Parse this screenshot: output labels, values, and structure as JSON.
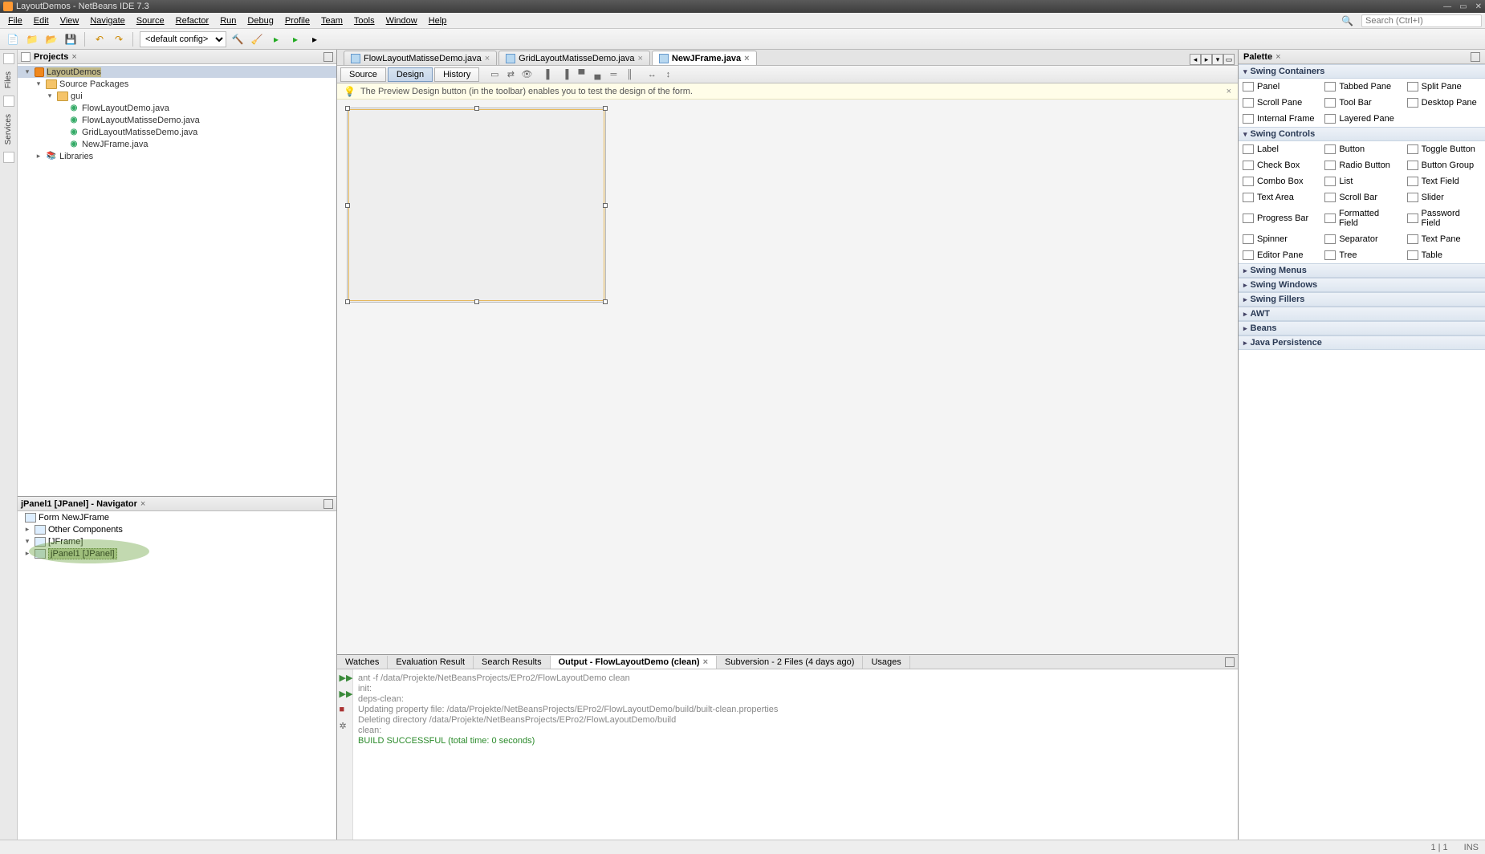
{
  "titlebar": {
    "text": "LayoutDemos - NetBeans IDE 7.3"
  },
  "menu": {
    "items": [
      "File",
      "Edit",
      "View",
      "Navigate",
      "Source",
      "Refactor",
      "Run",
      "Debug",
      "Profile",
      "Team",
      "Tools",
      "Window",
      "Help"
    ],
    "search_placeholder": "Search (Ctrl+I)"
  },
  "toolbar": {
    "config": "<default config>"
  },
  "leftrail": {
    "tabs": [
      "Files",
      "Services"
    ]
  },
  "projects": {
    "title": "Projects",
    "root": "LayoutDemos",
    "src": "Source Packages",
    "pkg": "gui",
    "files": [
      "FlowLayoutDemo.java",
      "FlowLayoutMatisseDemo.java",
      "GridLayoutMatisseDemo.java",
      "NewJFrame.java"
    ],
    "libs": "Libraries"
  },
  "navigator": {
    "title": "jPanel1 [JPanel] - Navigator",
    "form": "Form NewJFrame",
    "other": "Other Components",
    "jframe": "[JFrame]",
    "jpanel": "jPanel1 [JPanel]"
  },
  "editor_tabs": {
    "tabs": [
      {
        "label": "FlowLayoutMatisseDemo.java",
        "active": false
      },
      {
        "label": "GridLayoutMatisseDemo.java",
        "active": false
      },
      {
        "label": "NewJFrame.java",
        "active": true
      }
    ]
  },
  "ed_subbar": {
    "source": "Source",
    "design": "Design",
    "history": "History"
  },
  "hint": {
    "text": "The Preview Design button (in the toolbar) enables you to test the design of the form."
  },
  "palette": {
    "title": "Palette",
    "groups": [
      {
        "name": "Swing Containers",
        "open": true,
        "items": [
          "Panel",
          "Tabbed Pane",
          "Split Pane",
          "Scroll Pane",
          "Tool Bar",
          "Desktop Pane",
          "Internal Frame",
          "Layered Pane"
        ]
      },
      {
        "name": "Swing Controls",
        "open": true,
        "items": [
          "Label",
          "Button",
          "Toggle Button",
          "Check Box",
          "Radio Button",
          "Button Group",
          "Combo Box",
          "List",
          "Text Field",
          "Text Area",
          "Scroll Bar",
          "Slider",
          "Progress Bar",
          "Formatted Field",
          "Password Field",
          "Spinner",
          "Separator",
          "Text Pane",
          "Editor Pane",
          "Tree",
          "Table"
        ]
      },
      {
        "name": "Swing Menus",
        "open": false,
        "items": []
      },
      {
        "name": "Swing Windows",
        "open": false,
        "items": []
      },
      {
        "name": "Swing Fillers",
        "open": false,
        "items": []
      },
      {
        "name": "AWT",
        "open": false,
        "items": []
      },
      {
        "name": "Beans",
        "open": false,
        "items": []
      },
      {
        "name": "Java Persistence",
        "open": false,
        "items": []
      }
    ]
  },
  "bottom": {
    "tabs": [
      {
        "label": "Watches"
      },
      {
        "label": "Evaluation Result"
      },
      {
        "label": "Search Results"
      },
      {
        "label": "Output - FlowLayoutDemo (clean)",
        "active": true,
        "closable": true
      },
      {
        "label": "Subversion - 2 Files (4 days ago)"
      },
      {
        "label": "Usages"
      }
    ],
    "lines": [
      "ant -f /data/Projekte/NetBeansProjects/EPro2/FlowLayoutDemo clean",
      "init:",
      "deps-clean:",
      "Updating property file: /data/Projekte/NetBeansProjects/EPro2/FlowLayoutDemo/build/built-clean.properties",
      "Deleting directory /data/Projekte/NetBeansProjects/EPro2/FlowLayoutDemo/build",
      "clean:"
    ],
    "success": "BUILD SUCCESSFUL (total time: 0 seconds)"
  },
  "status": {
    "pos": "1 | 1",
    "ins": "INS"
  }
}
